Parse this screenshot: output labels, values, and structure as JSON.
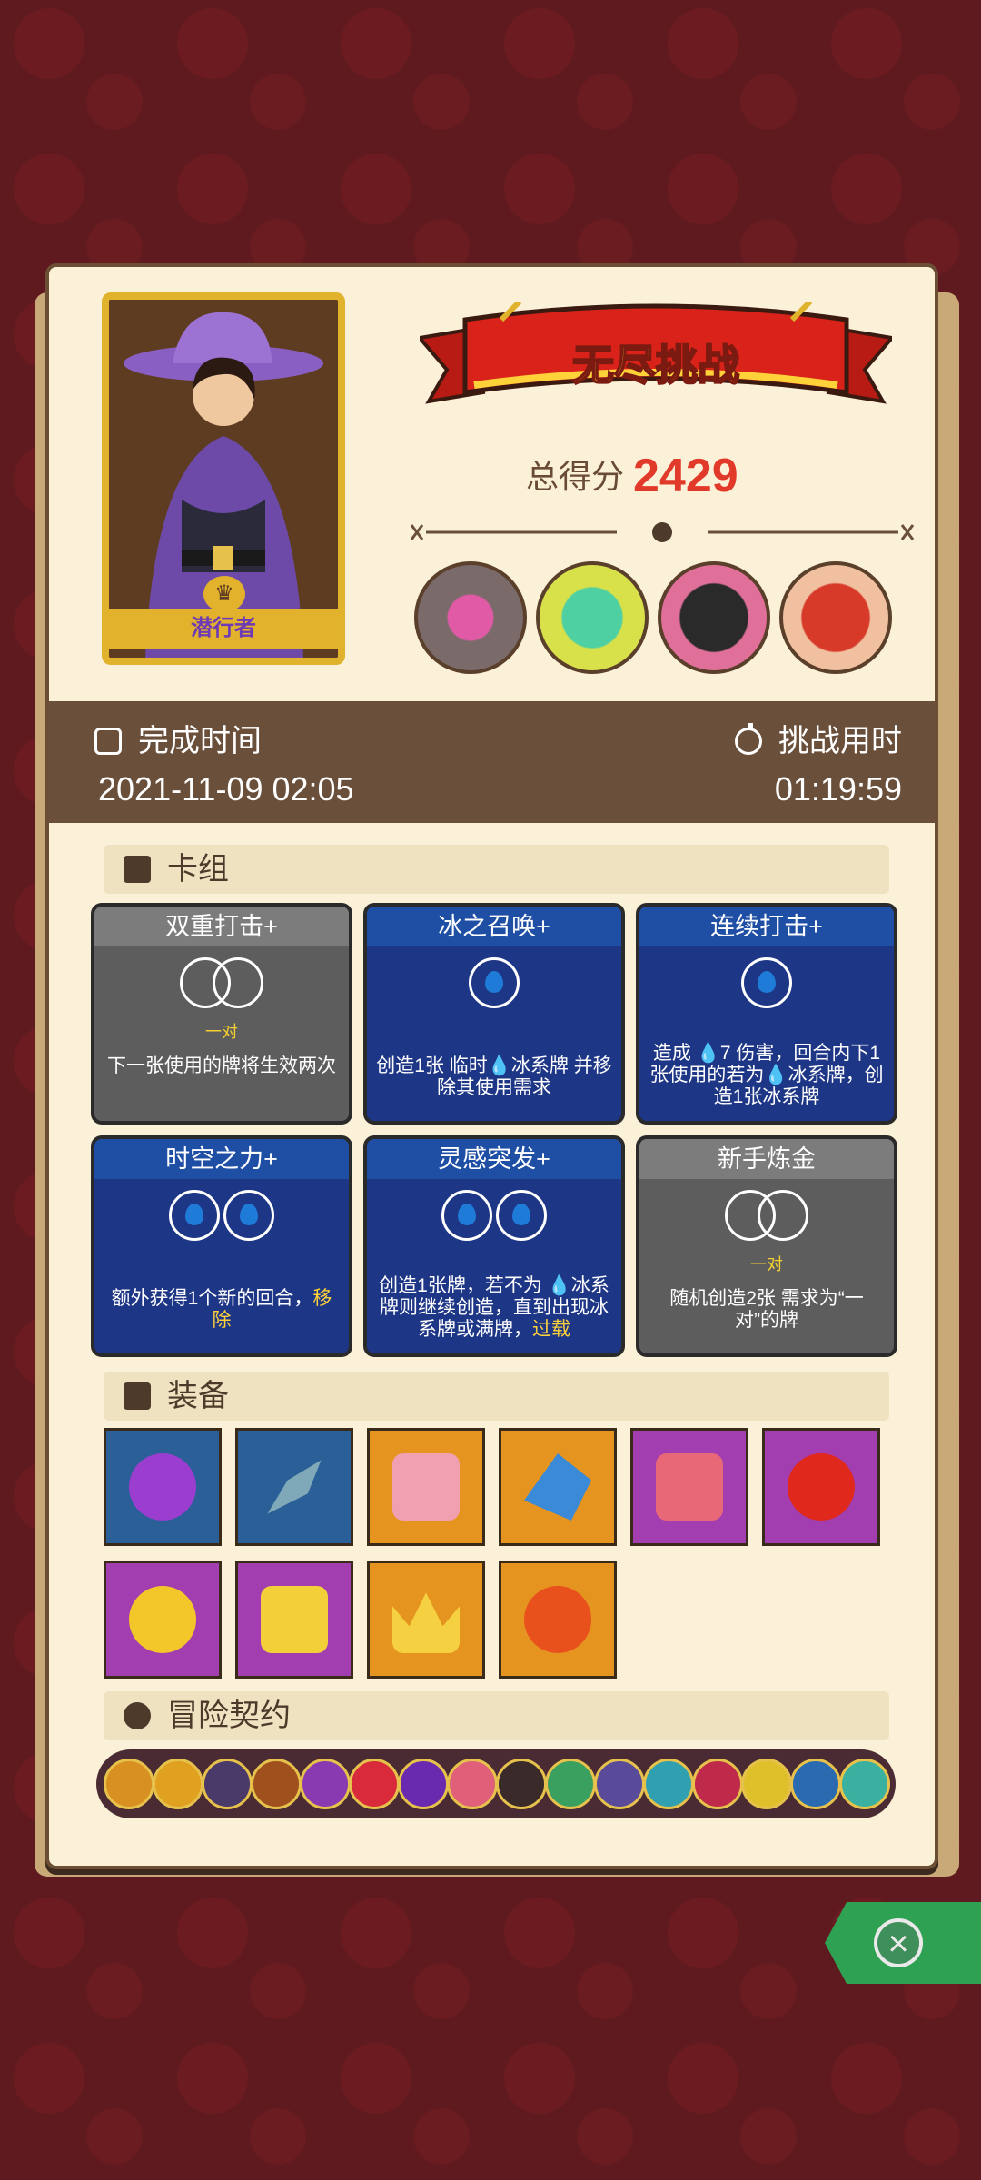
{
  "hero": {
    "name": "潜行者"
  },
  "banner": {
    "title": "无尽挑战"
  },
  "score": {
    "label": "总得分",
    "value": "2429"
  },
  "completion": {
    "label": "完成时间",
    "value": "2021-11-09 02:05"
  },
  "duration": {
    "label": "挑战用时",
    "value": "01:19:59"
  },
  "sections": {
    "deck": "卡组",
    "equipment": "装备",
    "contract": "冒险契约"
  },
  "cards": [
    {
      "title": "双重打击+",
      "style": "gray",
      "tag": "一对",
      "desc": "下一张使用的牌将生效两次"
    },
    {
      "title": "冰之召唤+",
      "style": "blue",
      "tag": "",
      "desc": "创造1张 临时💧冰系牌 并移除其使用需求"
    },
    {
      "title": "连续打击+",
      "style": "blue",
      "tag": "",
      "desc": "造成 💧7 伤害，回合内下1张使用的若为💧冰系牌，创造1张冰系牌"
    },
    {
      "title": "时空之力+",
      "style": "blue",
      "tag": "",
      "desc": "额外获得1个新的回合，",
      "desc_hl": "移除"
    },
    {
      "title": "灵感突发+",
      "style": "blue",
      "tag": "",
      "desc": "创造1张牌，若不为 💧冰系牌则继续创造，直到出现冰系牌或满牌，",
      "desc_hl": "过载"
    },
    {
      "title": "新手炼金",
      "style": "gray",
      "tag": "一对",
      "desc": "随机创造2张 需求为“一对”的牌"
    }
  ],
  "equipment": [
    {
      "icon": "purple-potion-icon",
      "bg": "#2a5f98"
    },
    {
      "icon": "scythe-blade-icon",
      "bg": "#2a5f98"
    },
    {
      "icon": "heart-box-icon",
      "bg": "#e69420"
    },
    {
      "icon": "blue-crystal-icon",
      "bg": "#e69420"
    },
    {
      "icon": "pink-slime-icon",
      "bg": "#a23eb0"
    },
    {
      "icon": "red-dagger-icon",
      "bg": "#a23eb0"
    },
    {
      "icon": "moon-star-icon",
      "bg": "#a23eb0"
    },
    {
      "icon": "yellow-box-icon",
      "bg": "#a23eb0"
    },
    {
      "icon": "golden-crown-icon",
      "bg": "#e69420"
    },
    {
      "icon": "fire-orb-icon",
      "bg": "#e69420"
    }
  ],
  "colors": {
    "banner_red": "#d8221a",
    "score_red": "#e23a2a",
    "time_bar": "#6a4f3b",
    "close_green": "#2fa152"
  }
}
